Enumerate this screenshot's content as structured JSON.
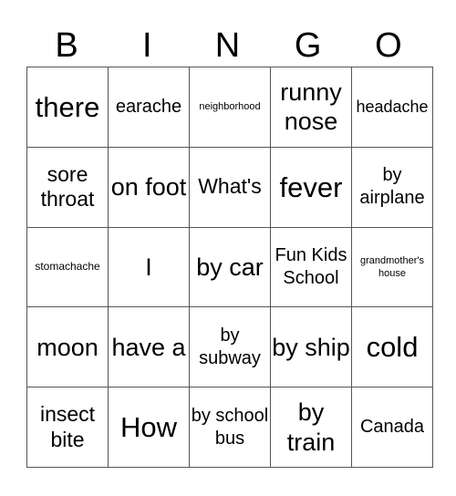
{
  "header": {
    "letters": [
      "B",
      "I",
      "N",
      "G",
      "O"
    ]
  },
  "grid": {
    "rows": [
      [
        "there",
        "earache",
        "neighborhood",
        "runny nose",
        "headache"
      ],
      [
        "sore throat",
        "on foot",
        "What's",
        "fever",
        "by airplane"
      ],
      [
        "stomachache",
        "I",
        "by car",
        "Fun Kids School",
        "grandmother's house"
      ],
      [
        "moon",
        "have a",
        "by subway",
        "by ship",
        "cold"
      ],
      [
        "insect bite",
        "How",
        "by school bus",
        "by train",
        "Canada"
      ]
    ]
  }
}
